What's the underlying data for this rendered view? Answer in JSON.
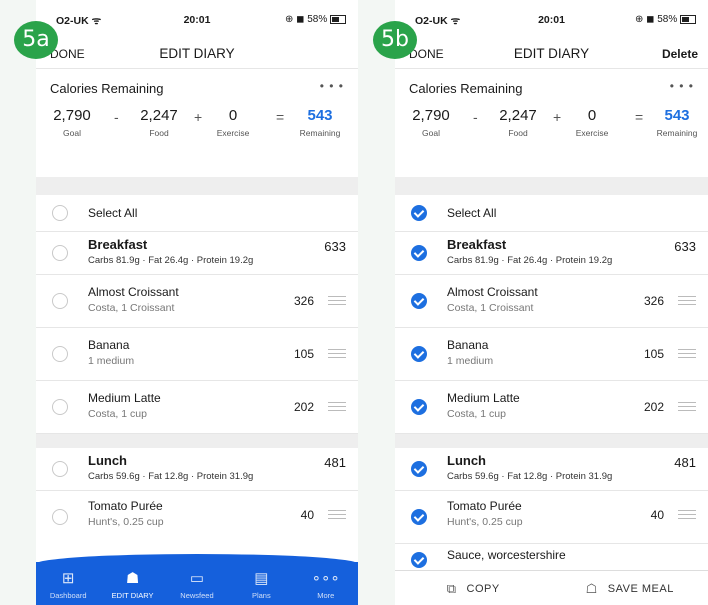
{
  "colors": {
    "accent": "#1d6fe0",
    "tab_bar": "#1560dc",
    "badge": "#2aa34a"
  },
  "left": {
    "badge": "5a",
    "status": {
      "carrier": "O2-UK",
      "time": "20:01",
      "battery": "58%"
    },
    "nav": {
      "done": "DONE",
      "title": "EDIT DIARY"
    },
    "summary": {
      "title": "Calories Remaining",
      "goal": "2,790",
      "goal_label": "Goal",
      "food": "2,247",
      "food_label": "Food",
      "exercise": "0",
      "exercise_label": "Exercise",
      "remaining": "543",
      "remaining_label": "Remaining"
    },
    "select_all": "Select All",
    "breakfast": {
      "name": "Breakfast",
      "calories": "633",
      "macros": "Carbs 81.9g · Fat 26.4g · Protein 19.2g"
    },
    "breakfast_items": [
      {
        "name": "Almost Croissant",
        "detail": "Costa, 1 Croissant",
        "calories": "326"
      },
      {
        "name": "Banana",
        "detail": "1 medium",
        "calories": "105"
      },
      {
        "name": "Medium Latte",
        "detail": "Costa, 1 cup",
        "calories": "202"
      }
    ],
    "lunch": {
      "name": "Lunch",
      "calories": "481",
      "macros": "Carbs 59.6g · Fat 12.8g · Protein 31.9g"
    },
    "lunch_items": [
      {
        "name": "Tomato Purée",
        "detail": "Hunt's, 0.25 cup",
        "calories": "40"
      }
    ],
    "tabs": [
      {
        "icon": "dashboard-icon",
        "label": "Dashboard"
      },
      {
        "icon": "edit-diary-icon",
        "label": "EDIT DIARY"
      },
      {
        "icon": "newsfeed-icon",
        "label": "Newsfeed"
      },
      {
        "icon": "plans-icon",
        "label": "Plans"
      },
      {
        "icon": "more-icon",
        "label": "More"
      }
    ]
  },
  "right": {
    "badge": "5b",
    "status": {
      "carrier": "O2-UK",
      "time": "20:01",
      "battery": "58%"
    },
    "nav": {
      "done": "DONE",
      "title": "EDIT DIARY",
      "delete": "Delete"
    },
    "summary": {
      "title": "Calories Remaining",
      "goal": "2,790",
      "goal_label": "Goal",
      "food": "2,247",
      "food_label": "Food",
      "exercise": "0",
      "exercise_label": "Exercise",
      "remaining": "543",
      "remaining_label": "Remaining"
    },
    "select_all": "Select All",
    "breakfast": {
      "name": "Breakfast",
      "calories": "633",
      "macros": "Carbs 81.9g · Fat 26.4g · Protein 19.2g"
    },
    "breakfast_items": [
      {
        "name": "Almost Croissant",
        "detail": "Costa, 1 Croissant",
        "calories": "326"
      },
      {
        "name": "Banana",
        "detail": "1 medium",
        "calories": "105"
      },
      {
        "name": "Medium Latte",
        "detail": "Costa, 1 cup",
        "calories": "202"
      }
    ],
    "lunch": {
      "name": "Lunch",
      "calories": "481",
      "macros": "Carbs 59.6g · Fat 12.8g · Protein 31.9g"
    },
    "lunch_items": [
      {
        "name": "Tomato Purée",
        "detail": "Hunt's, 0.25 cup",
        "calories": "40"
      },
      {
        "name": "Sauce, worcestershire"
      }
    ],
    "actions": {
      "copy": "COPY",
      "save_meal": "SAVE MEAL"
    }
  }
}
